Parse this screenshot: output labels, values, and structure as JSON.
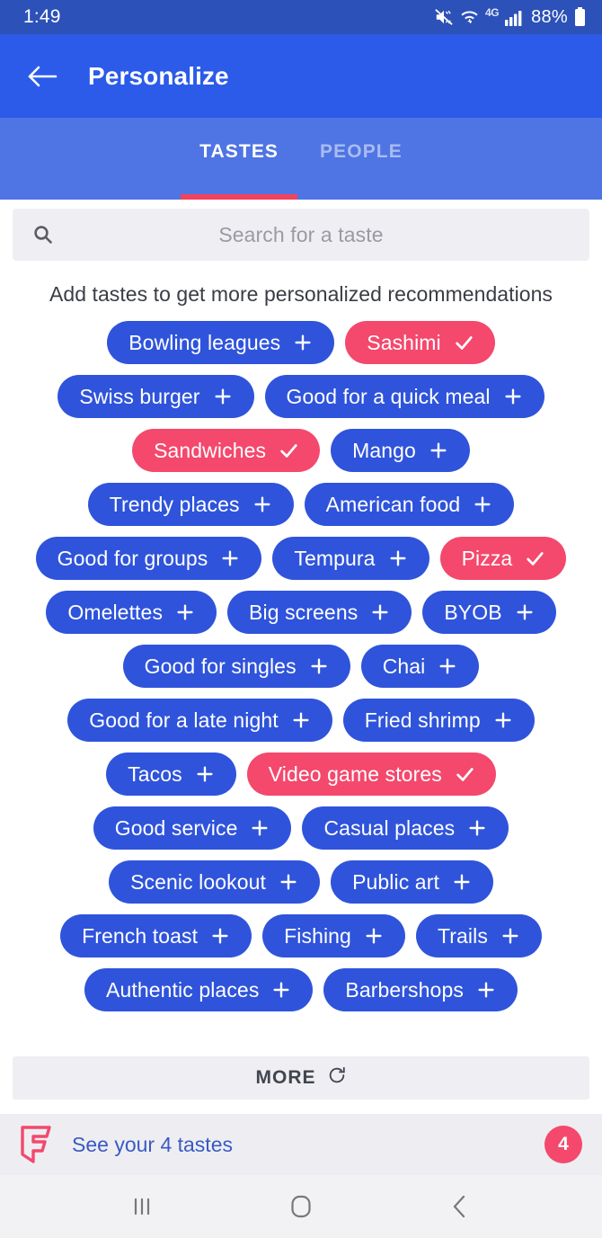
{
  "status_bar": {
    "time": "1:49",
    "battery_percent": "88%",
    "network_label": "4G",
    "icons": [
      "mute-vibrate-icon",
      "wifi-icon",
      "lte-icon",
      "signal-bars-icon",
      "battery-icon"
    ]
  },
  "app_bar": {
    "back_icon": "back-arrow-icon",
    "title": "Personalize"
  },
  "tabs": [
    {
      "label": "TASTES",
      "active": true
    },
    {
      "label": "PEOPLE",
      "active": false
    }
  ],
  "search": {
    "placeholder": "Search for a taste",
    "value": "",
    "icon": "search-icon"
  },
  "subtitle": "Add tastes to get more personalized recommendations",
  "chip_rows": [
    [
      {
        "label": "Bowling leagues",
        "state": "add"
      },
      {
        "label": "Sashimi",
        "state": "selected"
      }
    ],
    [
      {
        "label": "Swiss burger",
        "state": "add"
      },
      {
        "label": "Good for a quick meal",
        "state": "add"
      }
    ],
    [
      {
        "label": "Sandwiches",
        "state": "selected"
      },
      {
        "label": "Mango",
        "state": "add"
      }
    ],
    [
      {
        "label": "Trendy places",
        "state": "add"
      },
      {
        "label": "American food",
        "state": "add"
      }
    ],
    [
      {
        "label": "Good for groups",
        "state": "add"
      },
      {
        "label": "Tempura",
        "state": "add"
      },
      {
        "label": "Pizza",
        "state": "selected"
      }
    ],
    [
      {
        "label": "Omelettes",
        "state": "add"
      },
      {
        "label": "Big screens",
        "state": "add"
      },
      {
        "label": "BYOB",
        "state": "add"
      }
    ],
    [
      {
        "label": "Good for singles",
        "state": "add"
      },
      {
        "label": "Chai",
        "state": "add"
      }
    ],
    [
      {
        "label": "Good for a late night",
        "state": "add"
      },
      {
        "label": "Fried shrimp",
        "state": "add"
      }
    ],
    [
      {
        "label": "Tacos",
        "state": "add"
      },
      {
        "label": "Video game stores",
        "state": "selected"
      }
    ],
    [
      {
        "label": "Good service",
        "state": "add"
      },
      {
        "label": "Casual places",
        "state": "add"
      }
    ],
    [
      {
        "label": "Scenic lookout",
        "state": "add"
      },
      {
        "label": "Public art",
        "state": "add"
      }
    ],
    [
      {
        "label": "French toast",
        "state": "add"
      },
      {
        "label": "Fishing",
        "state": "add"
      },
      {
        "label": "Trails",
        "state": "add"
      }
    ],
    [
      {
        "label": "Authentic places",
        "state": "add"
      },
      {
        "label": "Barbershops",
        "state": "add"
      }
    ]
  ],
  "more_button": {
    "label": "MORE",
    "icon": "refresh-icon"
  },
  "footer": {
    "logo": "foursquare-logo",
    "text": "See your 4 tastes",
    "badge": "4"
  },
  "nav_bar": {
    "recents_icon": "recents-icon",
    "home_icon": "home-icon",
    "back_icon": "back-chevron-icon"
  },
  "colors": {
    "status_bar": "#2C51B8",
    "app_bar": "#2B5BE8",
    "tab_bar": "#4F74E3",
    "tab_indicator": "#F0435F",
    "chip_add": "#2F54DB",
    "chip_selected": "#F4486D",
    "search_bg": "#EFEFF3",
    "footer_bg": "#EEEEF2",
    "footer_link": "#3A5AC4"
  }
}
